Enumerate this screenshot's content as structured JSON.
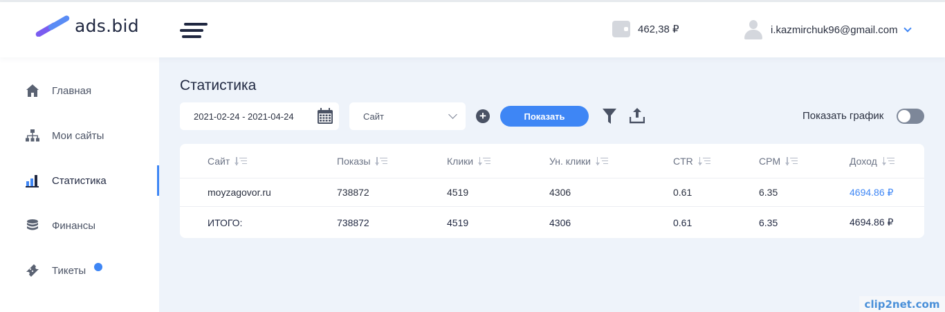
{
  "app": {
    "logo_text": "ads.bid"
  },
  "header": {
    "balance": "462,38 ₽",
    "user_email": "i.kazmirchuk96@gmail.com"
  },
  "sidebar": {
    "items": [
      {
        "label": "Главная",
        "icon": "home-icon"
      },
      {
        "label": "Мои сайты",
        "icon": "sitemap-icon"
      },
      {
        "label": "Статистика",
        "icon": "bar-chart-icon",
        "active": true
      },
      {
        "label": "Финансы",
        "icon": "coins-icon"
      },
      {
        "label": "Тикеты",
        "icon": "ticket-icon",
        "badge_dot": true
      }
    ]
  },
  "main": {
    "title": "Статистика",
    "date_range": "2021-02-24 - 2021-04-24",
    "site_select": "Сайт",
    "show_button": "Показать",
    "chart_toggle_label": "Показать график",
    "chart_toggle_on": false
  },
  "table": {
    "columns": [
      "Сайт",
      "Показы",
      "Клики",
      "Ун. клики",
      "CTR",
      "CPM",
      "Доход"
    ],
    "rows": [
      [
        "moyzagovor.ru",
        "738872",
        "4519",
        "4306",
        "0.61",
        "6.35",
        "4694.86 ₽"
      ]
    ],
    "total": [
      "ИТОГО:",
      "738872",
      "4519",
      "4306",
      "0.61",
      "6.35",
      "4694.86 ₽"
    ]
  },
  "watermark": "clip2net.com",
  "colors": {
    "accent": "#3e86f5",
    "background": "#eef3fa",
    "text": "#2a3040"
  }
}
